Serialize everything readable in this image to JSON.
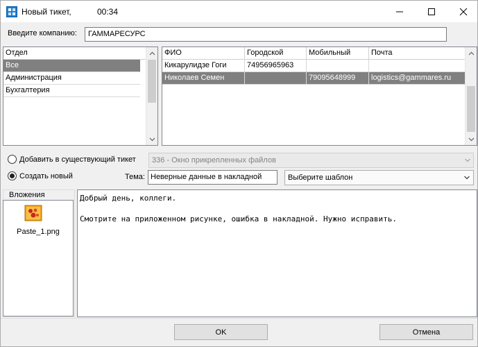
{
  "window": {
    "title": "Новый тикет,",
    "time": "00:34"
  },
  "company": {
    "label": "Введите компанию:",
    "value": "ГАММАРЕСУРС"
  },
  "departments": {
    "header": "Отдел",
    "items": [
      "Все",
      "Администрация",
      "Бухгалтерия"
    ],
    "selected_index": 0
  },
  "contacts": {
    "columns": [
      "ФИО",
      "Городской",
      "Мобильный",
      "Почта"
    ],
    "rows": [
      {
        "name": "Кикарулидзе Гоги",
        "phone": "74956965963",
        "mobile": "",
        "email": ""
      },
      {
        "name": "Николаев Семен",
        "phone": "",
        "mobile": "79095648999",
        "email": "logistics@gammares.ru"
      }
    ],
    "selected_index": 1
  },
  "options": {
    "add_existing_label": "Добавить в существующий тикет",
    "existing_ticket_value": "336 - Окно прикрепленных файлов",
    "create_new_label": "Создать новый",
    "selected": "create_new"
  },
  "subject": {
    "label": "Тема:",
    "value": "Неверные данные в накладной",
    "template_placeholder": "Выберите шаблон"
  },
  "attachments": {
    "title": "Вложения",
    "files": [
      {
        "name": "Paste_1.png",
        "icon": "image-file-icon"
      }
    ]
  },
  "message": {
    "lines": [
      "Добрый день, коллеги.",
      "",
      "Смотрите на приложенном рисунке, ошибка в накладной. Нужно исправить."
    ]
  },
  "buttons": {
    "ok": "OK",
    "cancel": "Отмена"
  },
  "colors": {
    "selection": "#808080",
    "window_bg": "#f0f0f0",
    "icon_orange": "#f2a31b",
    "icon_red": "#c62a1a"
  }
}
